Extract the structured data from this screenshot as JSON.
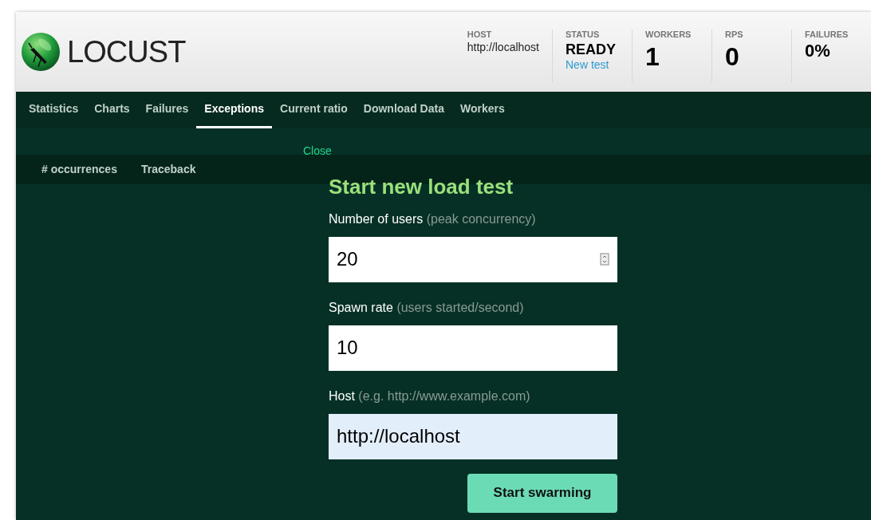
{
  "header": {
    "logo_text": "LOCUST",
    "stats": [
      {
        "kind": "text",
        "label": "HOST",
        "value": "http://localhost"
      },
      {
        "kind": "status",
        "label": "STATUS",
        "value": "READY",
        "link": "New test"
      },
      {
        "kind": "big",
        "label": "WORKERS",
        "value": "1"
      },
      {
        "kind": "big",
        "label": "RPS",
        "value": "0"
      },
      {
        "kind": "medium",
        "label": "FAILURES",
        "value": "0%"
      }
    ]
  },
  "tabs": [
    {
      "label": "Statistics",
      "selected": false
    },
    {
      "label": "Charts",
      "selected": false
    },
    {
      "label": "Failures",
      "selected": false
    },
    {
      "label": "Exceptions",
      "selected": true
    },
    {
      "label": "Current ratio",
      "selected": false
    },
    {
      "label": "Download Data",
      "selected": false
    },
    {
      "label": "Workers",
      "selected": false
    }
  ],
  "table": {
    "columns": [
      "# occurrences",
      "Traceback"
    ]
  },
  "modal": {
    "close": "Close",
    "title": "Start new load test",
    "fields": [
      {
        "kind": "number",
        "label": "Number of users",
        "hint": "(peak concurrency)",
        "value": "20",
        "autofilled": false
      },
      {
        "kind": "text",
        "label": "Spawn rate",
        "hint": "(users started/second)",
        "value": "10",
        "autofilled": false
      },
      {
        "kind": "text",
        "label": "Host",
        "hint": "(e.g. http://www.example.com)",
        "value": "http://localhost",
        "autofilled": true
      }
    ],
    "button": "Start swarming"
  }
}
